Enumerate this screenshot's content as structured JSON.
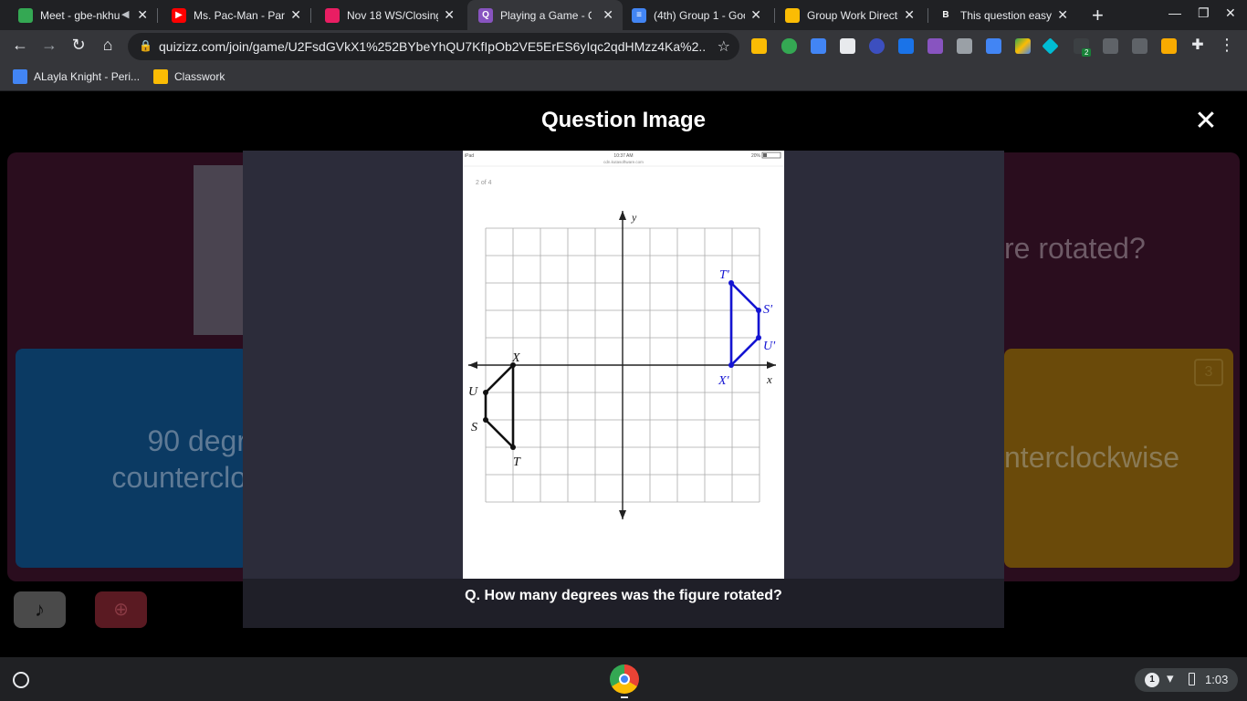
{
  "tabs": [
    {
      "title": "Meet - gbe-nkhu",
      "favicon_color": "#34a853",
      "favicon": "meet-icon"
    },
    {
      "title": "Ms. Pac-Man - Part",
      "favicon_color": "#ff0000",
      "favicon": "youtube-icon"
    },
    {
      "title": "Nov 18 WS/Closing",
      "favicon_color": "#e91e63",
      "favicon": "classroom-icon"
    },
    {
      "title": "Playing a Game - Q",
      "favicon_color": "#8854c0",
      "favicon": "quizizz-icon",
      "favicon_text": "Q",
      "active": true
    },
    {
      "title": "(4th) Group 1 - Goo",
      "favicon_color": "#4285f4",
      "favicon": "docs-icon"
    },
    {
      "title": "Group Work Directi",
      "favicon_color": "#fbbc04",
      "favicon": "slides-icon"
    },
    {
      "title": "This question easy",
      "favicon_color": "#202124",
      "favicon": "brainly-icon",
      "favicon_text": "B"
    }
  ],
  "address": {
    "url": "quizizz.com/join/game/U2FsdGVkX1%252BYbeYhQU7KfIpOb2VE5ErES6yIqc2qdHMzz4Ka%2..."
  },
  "bookmarks": [
    {
      "label": "ALayla Knight - Peri...",
      "icon": "docs-icon"
    },
    {
      "label": "Classwork",
      "icon": "classroom-icon"
    }
  ],
  "background": {
    "question_fragment": "re rotated?",
    "option_left": "90 degr counterclo",
    "option_right": "nterclockwise",
    "option_right_badge": "3"
  },
  "modal": {
    "title": "Question Image",
    "question": "Q. How many degrees was the figure rotated?",
    "image": {
      "status_left": "iPad",
      "status_time": "10:37 AM",
      "status_url": "cdn.kutasoftware.com",
      "status_battery": "20%",
      "page_label": "2 of 4",
      "axis_y": "y",
      "axis_x": "x",
      "original_labels": [
        "X",
        "U",
        "S",
        "T"
      ],
      "rotated_labels": [
        "T'",
        "S'",
        "U'",
        "X'"
      ]
    }
  },
  "taskbar": {
    "time": "1:03",
    "notification_count": "1",
    "ext_badge": "2"
  },
  "colors": {
    "rotated_figure": "#1414d2",
    "original_figure": "#111111",
    "quizizz_purple": "#8854c0"
  }
}
